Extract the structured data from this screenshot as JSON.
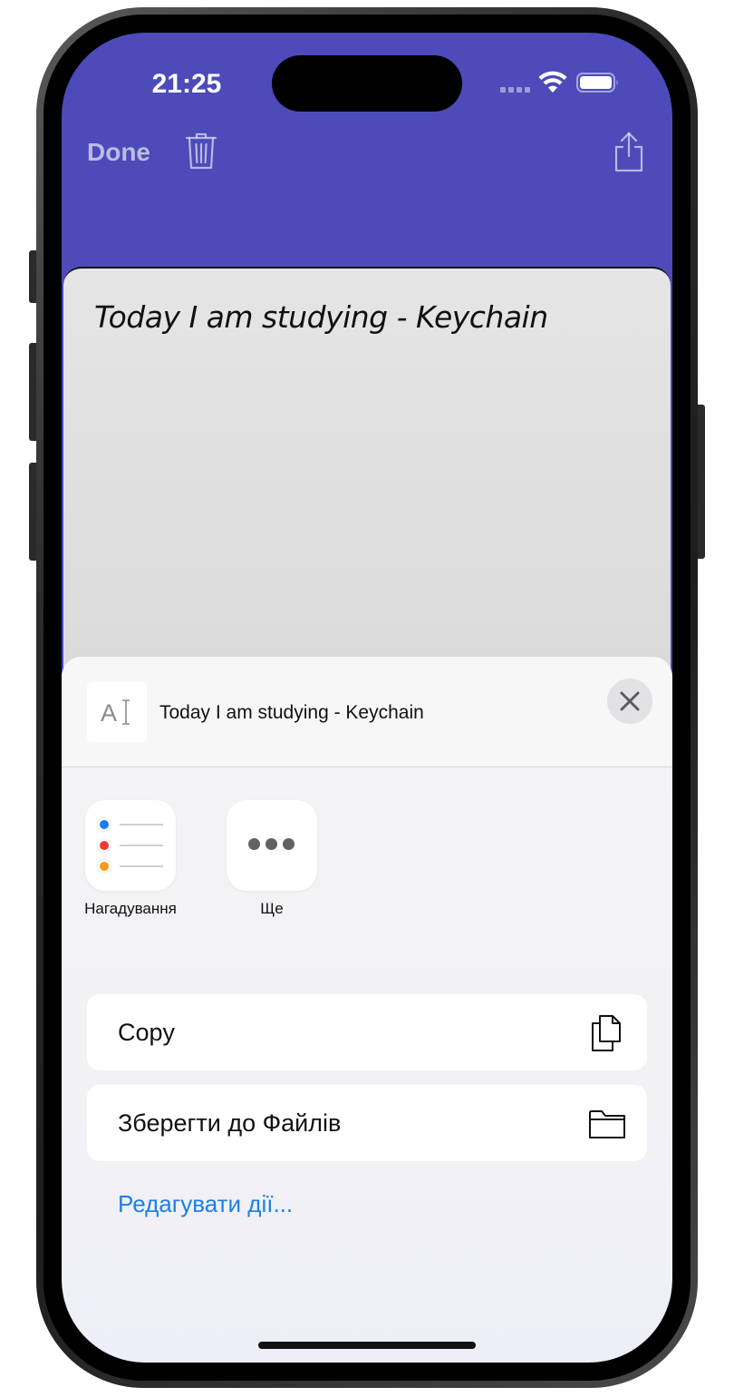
{
  "status_bar": {
    "time": "21:25"
  },
  "nav": {
    "done_label": "Done"
  },
  "note": {
    "title": "Today I am studying - Keychain"
  },
  "share_sheet": {
    "preview_title": "Today I am studying - Keychain",
    "preview_icon_glyph": "A⌶",
    "apps": [
      {
        "label": "Нагадування",
        "icon": "reminders-icon"
      },
      {
        "label": "Ще",
        "icon": "more-icon"
      }
    ],
    "actions": [
      {
        "label": "Copy",
        "icon": "copy-icon"
      },
      {
        "label": "Зберегти до Файлів",
        "icon": "folder-icon"
      }
    ],
    "edit_actions_label": "Редагувати дії..."
  },
  "colors": {
    "nav_background": "#4c4bb9",
    "link_blue": "#1c7fe6",
    "reminder_blue": "#1a7cf5",
    "reminder_red": "#ef3a32",
    "reminder_orange": "#f79a1a"
  }
}
